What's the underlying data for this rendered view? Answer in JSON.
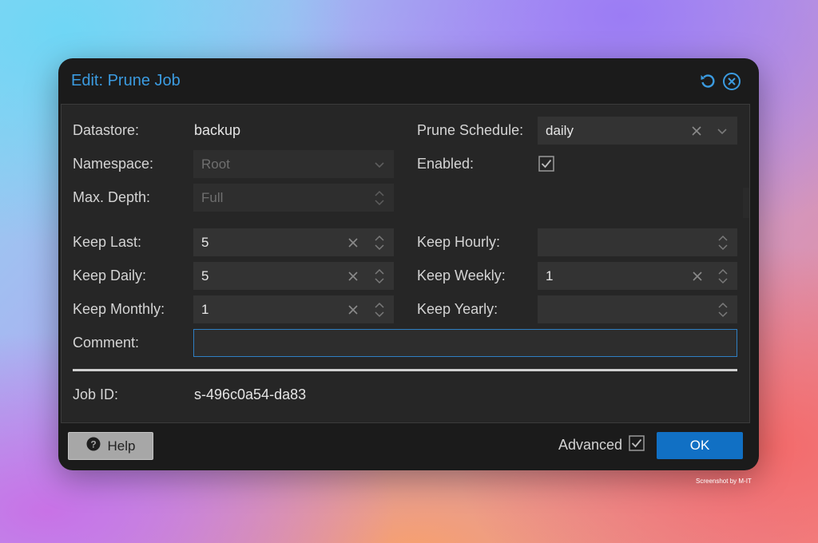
{
  "dialog": {
    "title": "Edit: Prune Job",
    "tools": [
      "refresh-icon",
      "close-icon"
    ]
  },
  "fields": {
    "datastore": {
      "label": "Datastore:",
      "value": "backup"
    },
    "namespace": {
      "label": "Namespace:",
      "value": "Root"
    },
    "max_depth": {
      "label": "Max. Depth:",
      "value": "Full"
    },
    "prune_schedule": {
      "label": "Prune Schedule:",
      "value": "daily"
    },
    "enabled": {
      "label": "Enabled:",
      "checked": true
    },
    "keep_last": {
      "label": "Keep Last:",
      "value": "5"
    },
    "keep_daily": {
      "label": "Keep Daily:",
      "value": "5"
    },
    "keep_monthly": {
      "label": "Keep Monthly:",
      "value": "1"
    },
    "keep_hourly": {
      "label": "Keep Hourly:",
      "value": ""
    },
    "keep_weekly": {
      "label": "Keep Weekly:",
      "value": "1"
    },
    "keep_yearly": {
      "label": "Keep Yearly:",
      "value": ""
    },
    "comment": {
      "label": "Comment:",
      "value": ""
    },
    "job_id": {
      "label": "Job ID:",
      "value": "s-496c0a54-da83"
    }
  },
  "footer": {
    "help_label": "Help",
    "advanced_label": "Advanced",
    "advanced_checked": true,
    "ok_label": "OK"
  },
  "watermark": "Screenshot by M-IT",
  "colors": {
    "accent": "#3b9be0",
    "primary_button": "#1170c4",
    "focus_border": "#2f7fc3"
  }
}
